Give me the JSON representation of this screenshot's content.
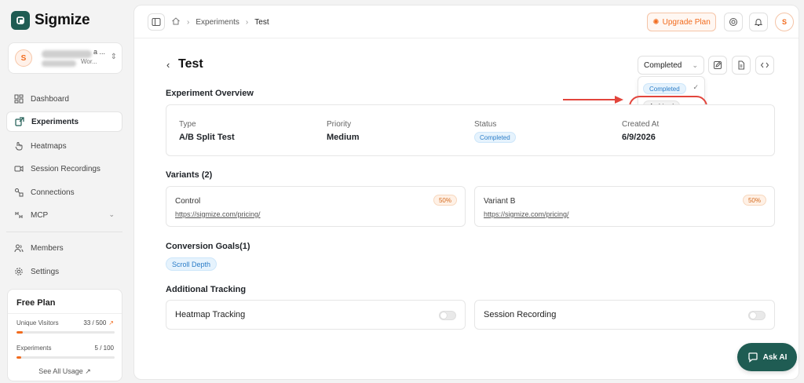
{
  "app": {
    "name": "Sigmize"
  },
  "workspace": {
    "avatar_initial": "S",
    "name_fragment": "a ...",
    "sub_fragment": "Wor..."
  },
  "sidebar": {
    "items": [
      {
        "label": "Dashboard",
        "icon": "dashboard-icon",
        "active": false
      },
      {
        "label": "Experiments",
        "icon": "experiments-icon",
        "active": true
      },
      {
        "label": "Heatmaps",
        "icon": "heatmaps-icon",
        "active": false
      },
      {
        "label": "Session Recordings",
        "icon": "video-icon",
        "active": false
      },
      {
        "label": "Connections",
        "icon": "connections-icon",
        "active": false
      },
      {
        "label": "MCP",
        "icon": "mcp-icon",
        "active": false
      }
    ],
    "bottom_items": [
      {
        "label": "Members",
        "icon": "members-icon"
      },
      {
        "label": "Settings",
        "icon": "settings-icon"
      }
    ]
  },
  "plan": {
    "title": "Free Plan",
    "usage": [
      {
        "label": "Unique Visitors",
        "value": "33 / 500",
        "fraction": 0.066,
        "trend": true
      },
      {
        "label": "Experiments",
        "value": "5 / 100",
        "fraction": 0.05,
        "trend": false
      }
    ],
    "see_all": "See All Usage ↗"
  },
  "topbar": {
    "breadcrumbs": [
      "Experiments",
      "Test"
    ],
    "upgrade_label": "Upgrade Plan",
    "user_initial": "S"
  },
  "page": {
    "title": "Test",
    "status_selected": "Completed",
    "status_options": [
      {
        "label": "Completed",
        "selected": true
      },
      {
        "label": "Archived",
        "selected": false
      }
    ]
  },
  "overview": {
    "heading": "Experiment Overview",
    "fields": [
      {
        "label": "Type",
        "value": "A/B Split Test"
      },
      {
        "label": "Priority",
        "value": "Medium"
      },
      {
        "label": "Status",
        "value": "Completed"
      },
      {
        "label": "Created At",
        "value": "6/9/2026"
      }
    ]
  },
  "variants": {
    "heading": "Variants (2)",
    "items": [
      {
        "name": "Control",
        "url": "https://sigmize.com/pricing/",
        "split": "50%"
      },
      {
        "name": "Variant B",
        "url": "https://sigmize.com/pricing/",
        "split": "50%"
      }
    ]
  },
  "goals": {
    "heading": "Conversion Goals(1)",
    "items": [
      "Scroll Depth"
    ]
  },
  "tracking": {
    "heading": "Additional Tracking",
    "items": [
      {
        "label": "Heatmap Tracking",
        "enabled": false
      },
      {
        "label": "Session Recording",
        "enabled": false
      }
    ]
  },
  "ask_ai": {
    "label": "Ask AI"
  },
  "colors": {
    "brand": "#1f5c53",
    "accent": "#f26b1d",
    "status_blue": "#2b7dc8",
    "annotation_red": "#e2453c"
  }
}
